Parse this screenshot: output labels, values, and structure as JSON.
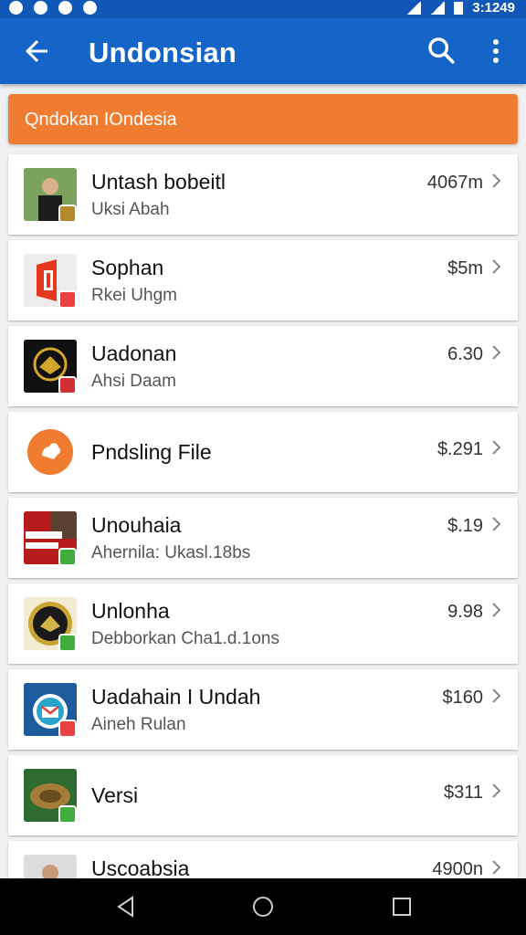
{
  "status": {
    "time": "3:1249"
  },
  "appbar": {
    "title": "Undonsian"
  },
  "banner": {
    "text": "Qndokan IOndesia"
  },
  "items": [
    {
      "name": "Untash bobeitl",
      "sub": "Uksi Abah",
      "price": "4067m",
      "thumb": "person-photo",
      "badge_color": "#b58a2e",
      "bg": "#4a7a3a"
    },
    {
      "name": "Sophan",
      "sub": "Rkei Uhgm",
      "price": "$5m",
      "thumb": "office-logo",
      "badge_color": "#e94040",
      "bg": "#e6e6e6"
    },
    {
      "name": "Uadonan",
      "sub": "Ahsi Daam",
      "price": "6.30",
      "thumb": "emblem",
      "badge_color": "#d13030",
      "bg": "#111111"
    },
    {
      "name": "Pndsling File",
      "sub": "",
      "price": "$.291",
      "thumb": "orange-circle",
      "badge_color": "",
      "bg": "#ffffff"
    },
    {
      "name": "Unouhaia",
      "sub": "Ahernila: Ukasl.18bs",
      "price": "$.19",
      "thumb": "poster",
      "badge_color": "#3fae3f",
      "bg": "#b71c1c"
    },
    {
      "name": "Unlonha",
      "sub": "Debborkan Cha1.d.1ons",
      "price": "9.98",
      "thumb": "gold-seal",
      "badge_color": "#3fae3f",
      "bg": "#f3e9c6"
    },
    {
      "name": "Uadahain I Undah",
      "sub": "Aineh Rulan",
      "price": "$160",
      "thumb": "mail-app",
      "badge_color": "#e94040",
      "bg": "#1d5b9c"
    },
    {
      "name": "Versi",
      "sub": "",
      "price": "$311",
      "thumb": "garuda",
      "badge_color": "#3fae3f",
      "bg": "#2e6b2e"
    },
    {
      "name": "Uscoabsia",
      "sub": "",
      "price": "4900n",
      "thumb": "person-photo-2",
      "badge_color": "",
      "bg": "#dcdcdc"
    }
  ]
}
